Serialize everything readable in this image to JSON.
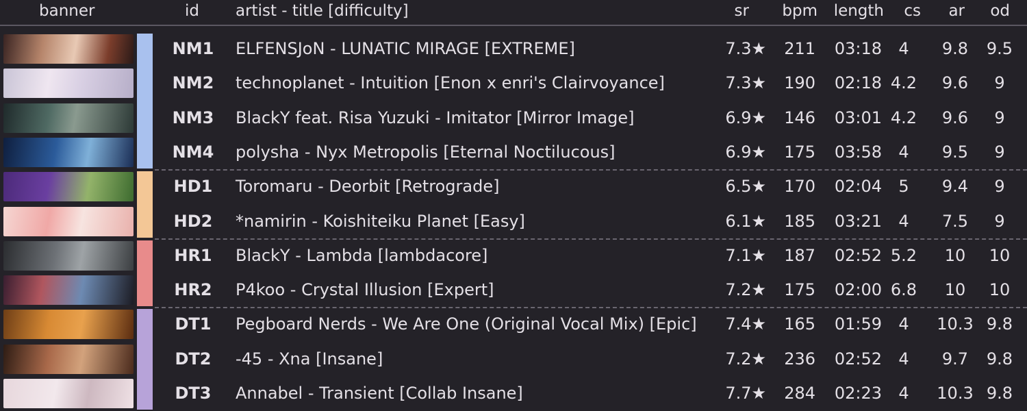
{
  "header": {
    "banner": "banner",
    "id": "id",
    "title": "artist - title [difficulty]",
    "sr": "sr",
    "bpm": "bpm",
    "length": "length",
    "cs": "cs",
    "ar": "ar",
    "od": "od"
  },
  "mods": {
    "NM": {
      "color": "#a9c1ee"
    },
    "HD": {
      "color": "#f3c796"
    },
    "HR": {
      "color": "#e88b8b"
    },
    "DT": {
      "color": "#b7a3d9"
    }
  },
  "rows": [
    {
      "id": "NM1",
      "title": "ELFENSJoN - LUNATIC MIRAGE [EXTREME]",
      "sr": "7.3★",
      "bpm": "211",
      "length": "03:18",
      "cs": "4",
      "ar": "9.8",
      "od": "9.5"
    },
    {
      "id": "NM2",
      "title": "technoplanet - Intuition [Enon x enri's Clairvoyance]",
      "sr": "7.3★",
      "bpm": "190",
      "length": "02:18",
      "cs": "4.2",
      "ar": "9.6",
      "od": "9"
    },
    {
      "id": "NM3",
      "title": "BlackY feat. Risa Yuzuki - Imitator [Mirror Image]",
      "sr": "6.9★",
      "bpm": "146",
      "length": "03:01",
      "cs": "4.2",
      "ar": "9.6",
      "od": "9"
    },
    {
      "id": "NM4",
      "title": "polysha - Nyx Metropolis [Eternal Noctilucous]",
      "sr": "6.9★",
      "bpm": "175",
      "length": "03:58",
      "cs": "4",
      "ar": "9.5",
      "od": "9"
    },
    {
      "id": "HD1",
      "title": "Toromaru - Deorbit [Retrograde]",
      "sr": "6.5★",
      "bpm": "170",
      "length": "02:04",
      "cs": "5",
      "ar": "9.4",
      "od": "9"
    },
    {
      "id": "HD2",
      "title": "*namirin - Koishiteiku Planet [Easy]",
      "sr": "6.1★",
      "bpm": "185",
      "length": "03:21",
      "cs": "4",
      "ar": "7.5",
      "od": "9"
    },
    {
      "id": "HR1",
      "title": "BlackY - Lambda [lambdacore]",
      "sr": "7.1★",
      "bpm": "187",
      "length": "02:52",
      "cs": "5.2",
      "ar": "10",
      "od": "10"
    },
    {
      "id": "HR2",
      "title": "P4koo - Crystal Illusion [Expert]",
      "sr": "7.2★",
      "bpm": "175",
      "length": "02:00",
      "cs": "6.8",
      "ar": "10",
      "od": "10"
    },
    {
      "id": "DT1",
      "title": "Pegboard Nerds - We Are One (Original Vocal Mix) [Epic]",
      "sr": "7.4★",
      "bpm": "165",
      "length": "01:59",
      "cs": "4",
      "ar": "10.3",
      "od": "9.8"
    },
    {
      "id": "DT2",
      "title": "-45 - Xna [Insane]",
      "sr": "7.2★",
      "bpm": "236",
      "length": "02:52",
      "cs": "4",
      "ar": "9.7",
      "od": "9.8"
    },
    {
      "id": "DT3",
      "title": "Annabel - Transient [Collab Insane]",
      "sr": "7.7★",
      "bpm": "284",
      "length": "02:23",
      "cs": "4",
      "ar": "10.3",
      "od": "9.8"
    }
  ]
}
